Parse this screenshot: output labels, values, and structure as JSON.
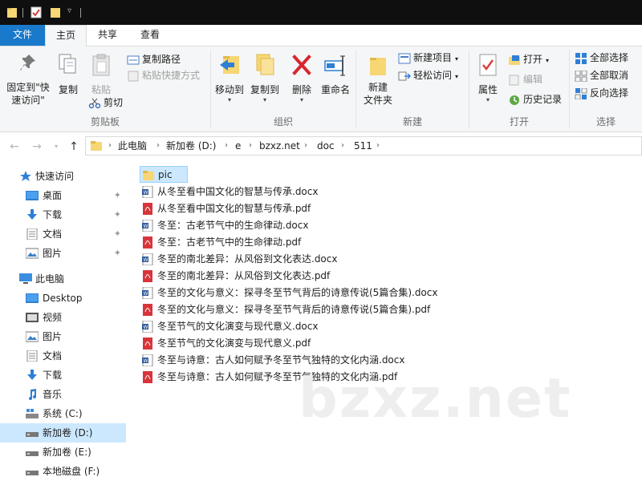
{
  "ribbon_tabs": {
    "file": "文件",
    "home": "主页",
    "share": "共享",
    "view": "查看"
  },
  "clipboard": {
    "pin": "固定到\"快速访问\"",
    "copy": "复制",
    "paste": "粘贴",
    "copy_path": "复制路径",
    "paste_shortcut": "粘贴快捷方式",
    "cut": "剪切",
    "group_label": "剪贴板"
  },
  "organize": {
    "move_to": "移动到",
    "copy_to": "复制到",
    "delete": "删除",
    "rename": "重命名",
    "group_label": "组织"
  },
  "new": {
    "new_folder": "新建\n文件夹",
    "new_item": "新建项目",
    "easy_access": "轻松访问",
    "group_label": "新建"
  },
  "open": {
    "properties": "属性",
    "open": "打开",
    "edit": "编辑",
    "history": "历史记录",
    "group_label": "打开"
  },
  "select": {
    "select_all": "全部选择",
    "select_none": "全部取消",
    "invert": "反向选择",
    "group_label": "选择"
  },
  "breadcrumb": [
    "此电脑",
    "新加卷 (D:)",
    "e",
    "bzxz.net",
    "doc",
    "511"
  ],
  "nav": {
    "quick_access": "快速访问",
    "quick_items": [
      "桌面",
      "下载",
      "文档",
      "图片"
    ],
    "this_pc": "此电脑",
    "pc_items": [
      "Desktop",
      "视频",
      "图片",
      "文档",
      "下载",
      "音乐",
      "系统 (C:)",
      "新加卷 (D:)",
      "新加卷 (E:)",
      "本地磁盘 (F:)"
    ]
  },
  "files": [
    {
      "name": "pic",
      "type": "folder"
    },
    {
      "name": "从冬至看中国文化的智慧与传承.docx",
      "type": "docx"
    },
    {
      "name": "从冬至看中国文化的智慧与传承.pdf",
      "type": "pdf"
    },
    {
      "name": "冬至：古老节气中的生命律动.docx",
      "type": "docx"
    },
    {
      "name": "冬至：古老节气中的生命律动.pdf",
      "type": "pdf"
    },
    {
      "name": "冬至的南北差异：从风俗到文化表达.docx",
      "type": "docx"
    },
    {
      "name": "冬至的南北差异：从风俗到文化表达.pdf",
      "type": "pdf"
    },
    {
      "name": "冬至的文化与意义：探寻冬至节气背后的诗意传说(5篇合集).docx",
      "type": "docx"
    },
    {
      "name": "冬至的文化与意义：探寻冬至节气背后的诗意传说(5篇合集).pdf",
      "type": "pdf"
    },
    {
      "name": "冬至节气的文化演变与现代意义.docx",
      "type": "docx"
    },
    {
      "name": "冬至节气的文化演变与现代意义.pdf",
      "type": "pdf"
    },
    {
      "name": "冬至与诗意：古人如何赋予冬至节气独特的文化内涵.docx",
      "type": "docx"
    },
    {
      "name": "冬至与诗意：古人如何赋予冬至节气独特的文化内涵.pdf",
      "type": "pdf"
    }
  ],
  "watermark": "bzxz.net",
  "colors": {
    "accent": "#1979ca",
    "selection": "#cce8ff",
    "folder": "#f7d674",
    "pdf": "#d7353b",
    "docx": "#2b579a"
  }
}
